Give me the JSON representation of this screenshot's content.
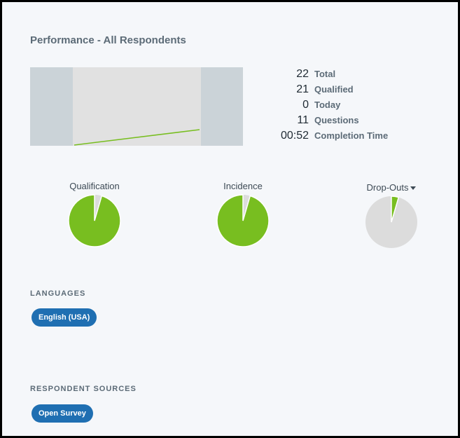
{
  "performance": {
    "title": "Performance - All Respondents",
    "trend": {
      "start": 0,
      "end": 22
    },
    "stats": [
      {
        "value": "22",
        "label": "Total"
      },
      {
        "value": "21",
        "label": "Qualified"
      },
      {
        "value": "0",
        "label": "Today"
      },
      {
        "value": "11",
        "label": "Questions"
      },
      {
        "value": "00:52",
        "label": "Completion Time"
      }
    ]
  },
  "pies": {
    "qualification": {
      "label": "Qualification",
      "fraction": 0.955
    },
    "incidence": {
      "label": "Incidence",
      "fraction": 0.955
    },
    "dropouts": {
      "label": "Drop-Outs",
      "fraction": 0.045
    }
  },
  "colors": {
    "green": "#78be20",
    "grey": "#dcdcdc",
    "blue": "#1f6fb2"
  },
  "languages": {
    "heading": "LANGUAGES",
    "items": [
      "English (USA)"
    ]
  },
  "respondent_sources": {
    "heading": "RESPONDENT SOURCES",
    "items": [
      "Open Survey"
    ]
  }
}
